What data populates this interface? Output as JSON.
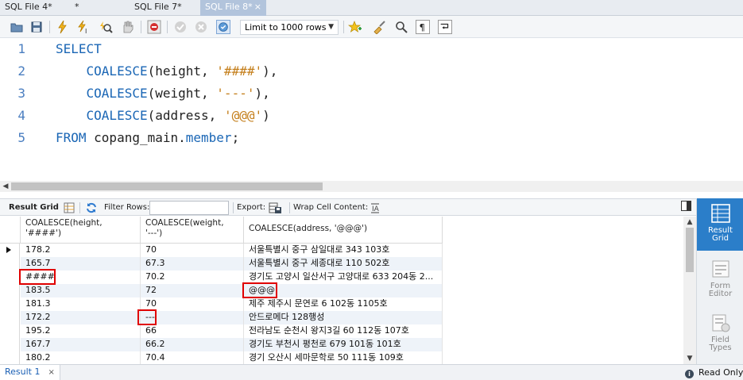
{
  "tabs": [
    {
      "label": "SQL File 4*",
      "extra": "*",
      "active": false
    },
    {
      "label": "SQL File 7*",
      "active": false
    },
    {
      "label": "SQL File 8*",
      "active": true
    }
  ],
  "tab_close_glyph": "×",
  "toolbar": {
    "limit_label": "Limit to 1000 rows"
  },
  "editor": {
    "line_numbers": [
      "1",
      "2",
      "3",
      "4",
      "5"
    ],
    "lines": [
      {
        "kw": "SELECT"
      },
      {
        "indent": "    ",
        "fn": "COALESCE",
        "open": "(",
        "arg": "height, ",
        "str": "'####'",
        "close": "),"
      },
      {
        "indent": "    ",
        "fn": "COALESCE",
        "open": "(",
        "arg": "weight, ",
        "str": "'---'",
        "close": "),"
      },
      {
        "indent": "    ",
        "fn": "COALESCE",
        "open": "(",
        "arg": "address, ",
        "str": "'@@@'",
        "close": ")"
      },
      {
        "kw": "FROM",
        "text": " copang_main.",
        "kw2": "member",
        "tail": ";"
      }
    ]
  },
  "result_toolbar": {
    "result_grid_label": "Result Grid",
    "filter_rows_label": "Filter Rows:",
    "filter_value": "",
    "export_label": "Export:",
    "wrap_label": "Wrap Cell Content:"
  },
  "grid": {
    "columns": [
      "COALESCE(height,\n'####')",
      "COALESCE(weight,\n'---')",
      "COALESCE(address, '@@@')"
    ],
    "rows": [
      [
        "178.2",
        "70",
        "서울특별시 중구 삼일대로 343 103호"
      ],
      [
        "165.7",
        "67.3",
        "서울특별시 중구 세종대로 110 502호"
      ],
      [
        "####",
        "70.2",
        "경기도 고양시 일산서구 고양대로 633 204동 2..."
      ],
      [
        "183.5",
        "72",
        "@@@"
      ],
      [
        "181.3",
        "70",
        "제주 제주시 문연로 6 102동 1105호"
      ],
      [
        "172.2",
        "---",
        "안드로메다 128행성"
      ],
      [
        "195.2",
        "66",
        "전라남도 순천시 왕지3길 60 112동 107호"
      ],
      [
        "167.7",
        "66.2",
        "경기도 부천시 평천로 679 101동 101호"
      ],
      [
        "180.2",
        "70.4",
        "경기 오산시 세마문학로 50 111동 109호"
      ]
    ],
    "current_row": 0
  },
  "side_panel": {
    "result_grid": "Result\nGrid",
    "form_editor": "Form\nEditor",
    "field_types": "Field\nTypes"
  },
  "status": {
    "result_tab": "Result 1",
    "read_only": "Read Only",
    "info_glyph": "i"
  },
  "colors": {
    "keyword": "#1a66b5",
    "string": "#c47e1a",
    "highlight": "#e00000",
    "active_panel": "#2b7ec9"
  }
}
